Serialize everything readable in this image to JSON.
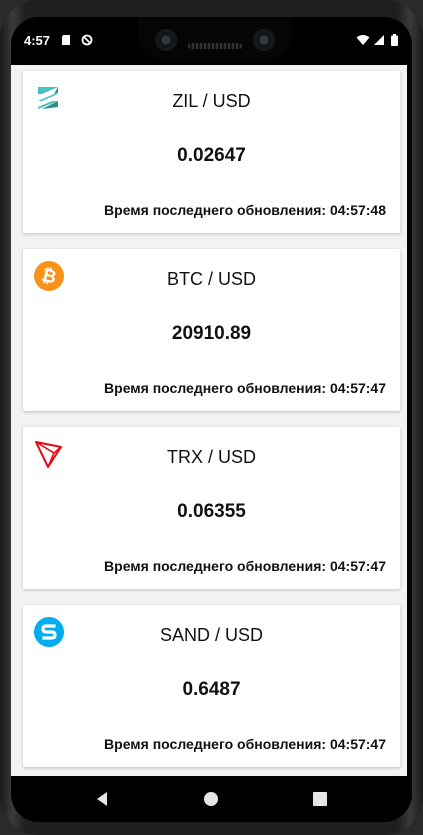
{
  "status_bar": {
    "time": "4:57",
    "icons": [
      "sd-card-icon",
      "vpn-icon",
      "wifi-icon",
      "signal-icon",
      "battery-icon"
    ]
  },
  "colors": {
    "zil": "#49c1bf",
    "btc": "#f7931a",
    "trx": "#e50915",
    "sand": "#00adef"
  },
  "cards": [
    {
      "icon": "zilliqa-icon",
      "pair": "ZIL / USD",
      "price": "0.02647",
      "updated_label": "Время последнего обновления: 04:57:48"
    },
    {
      "icon": "bitcoin-icon",
      "pair": "BTC / USD",
      "price": "20910.89",
      "updated_label": "Время последнего обновления: 04:57:47"
    },
    {
      "icon": "tron-icon",
      "pair": "TRX / USD",
      "price": "0.06355",
      "updated_label": "Время последнего обновления: 04:57:47"
    },
    {
      "icon": "sandbox-icon",
      "pair": "SAND / USD",
      "price": "0.6487",
      "updated_label": "Время последнего обновления: 04:57:47"
    }
  ],
  "nav_bar": {
    "buttons": [
      "back-icon",
      "home-icon",
      "recents-icon"
    ]
  }
}
